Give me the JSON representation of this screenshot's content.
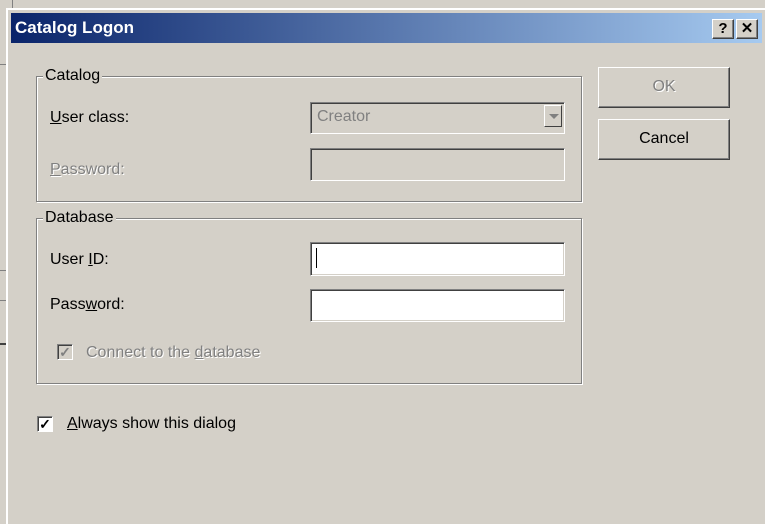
{
  "dialog": {
    "title": "Catalog Logon",
    "help_button": "?",
    "close_button": "✕"
  },
  "catalog_group": {
    "legend": "Catalog",
    "user_class_label": "User class:",
    "user_class_value": "Creator",
    "password_label": "Password:"
  },
  "database_group": {
    "legend": "Database",
    "user_id_label": "User ID:",
    "user_id_value": "",
    "password_label": "Password:",
    "password_value": "",
    "connect_label": "Connect to the database",
    "connect_checked": true
  },
  "always_show": {
    "label": "Always show this dialog",
    "checked": true
  },
  "buttons": {
    "ok": "OK",
    "cancel": "Cancel"
  },
  "colors": {
    "titlebar_start": "#0a246a",
    "titlebar_end": "#a6caf0",
    "face": "#d4d0c8",
    "disabled_text": "#808080"
  }
}
